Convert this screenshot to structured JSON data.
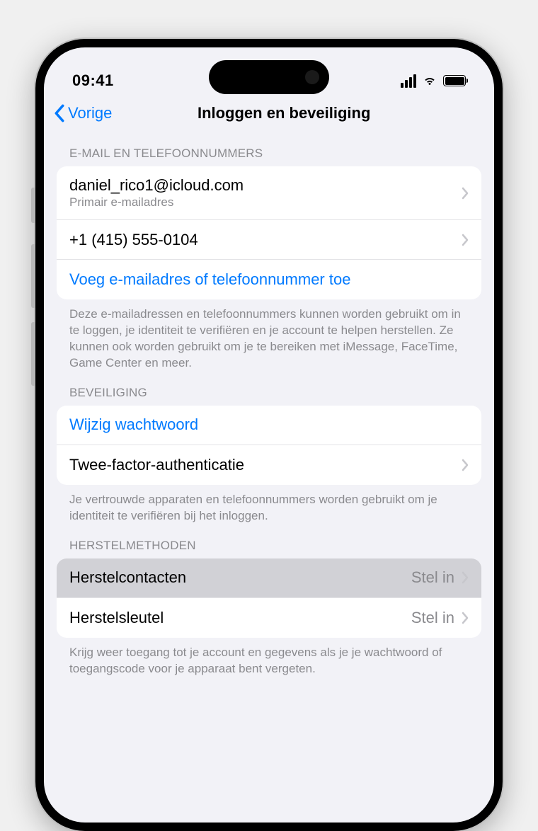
{
  "status": {
    "time": "09:41"
  },
  "nav": {
    "back": "Vorige",
    "title": "Inloggen en beveiliging"
  },
  "sections": {
    "email": {
      "header": "E-MAIL EN TELEFOONNUMMERS",
      "primary_email": "daniel_rico1@icloud.com",
      "primary_email_sub": "Primair e-mailadres",
      "phone": "+1 (415) 555-0104",
      "add": "Voeg e-mailadres of telefoonnummer toe",
      "footer": "Deze e-mailadressen en telefoonnummers kunnen worden gebruikt om in te loggen, je identiteit te verifiëren en je account te helpen herstellen. Ze kunnen ook worden gebruikt om je te bereiken met iMessage, FaceTime, Game Center en meer."
    },
    "security": {
      "header": "BEVEILIGING",
      "change_password": "Wijzig wachtwoord",
      "two_factor": "Twee-factor-authenticatie",
      "footer": "Je vertrouwde apparaten en telefoonnummers worden gebruikt om je identiteit te verifiëren bij het inloggen."
    },
    "recovery": {
      "header": "HERSTELMETHODEN",
      "contacts": "Herstelcontacten",
      "contacts_value": "Stel in",
      "key": "Herstelsleutel",
      "key_value": "Stel in",
      "footer": "Krijg weer toegang tot je account en gegevens als je je wachtwoord of toegangscode voor je apparaat bent vergeten."
    }
  }
}
